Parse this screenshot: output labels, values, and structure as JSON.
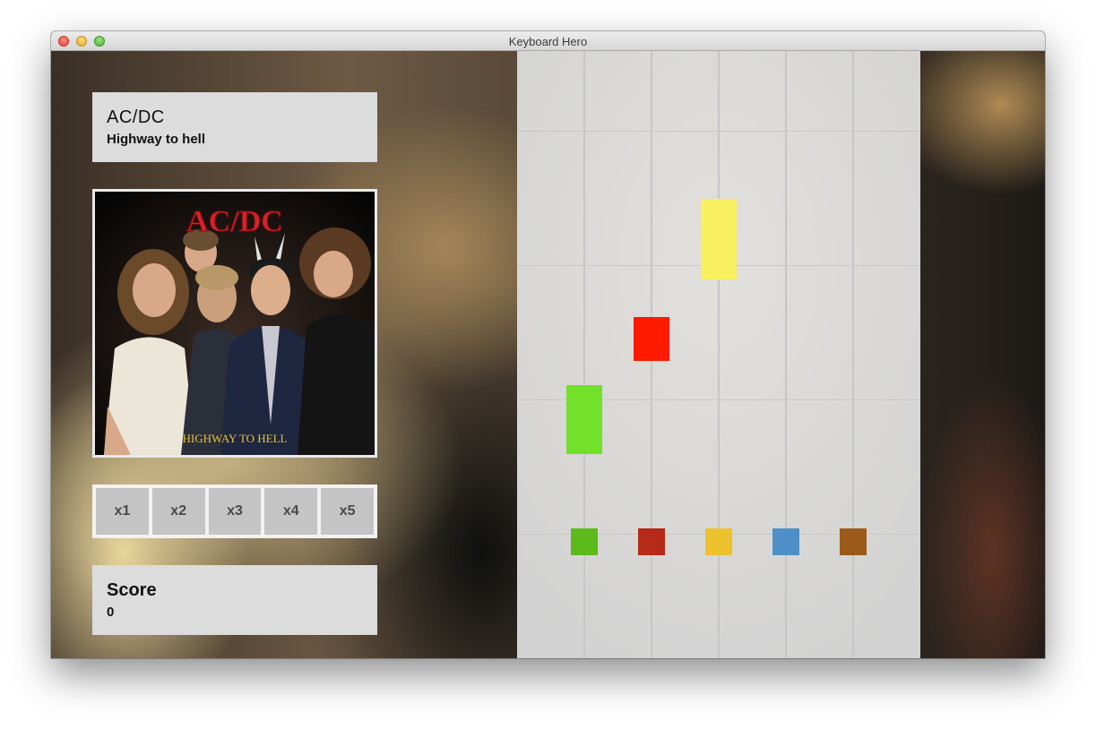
{
  "window": {
    "title": "Keyboard Hero"
  },
  "song": {
    "artist": "AC/DC",
    "title": "Highway to hell"
  },
  "album": {
    "logo": "AC/DC",
    "caption": "HIGHWAY TO HELL",
    "logo_color": "#d8222a",
    "caption_color": "#e8c040"
  },
  "multipliers": [
    "x1",
    "x2",
    "x3",
    "x4",
    "x5"
  ],
  "score": {
    "label": "Score",
    "value": "0"
  },
  "board": {
    "lanes": 5,
    "falling_notes": [
      {
        "lane": 1,
        "color": "#73e02a"
      },
      {
        "lane": 2,
        "color": "#ff1a00"
      },
      {
        "lane": 3,
        "color": "#f8f060"
      }
    ],
    "targets": [
      {
        "lane": 1,
        "color": "#5cba1a",
        "key": "green"
      },
      {
        "lane": 2,
        "color": "#b52a19",
        "key": "red"
      },
      {
        "lane": 3,
        "color": "#eec22e",
        "key": "yellow"
      },
      {
        "lane": 4,
        "color": "#4f8fc8",
        "key": "blue"
      },
      {
        "lane": 5,
        "color": "#9c5a1a",
        "key": "orange"
      }
    ]
  }
}
